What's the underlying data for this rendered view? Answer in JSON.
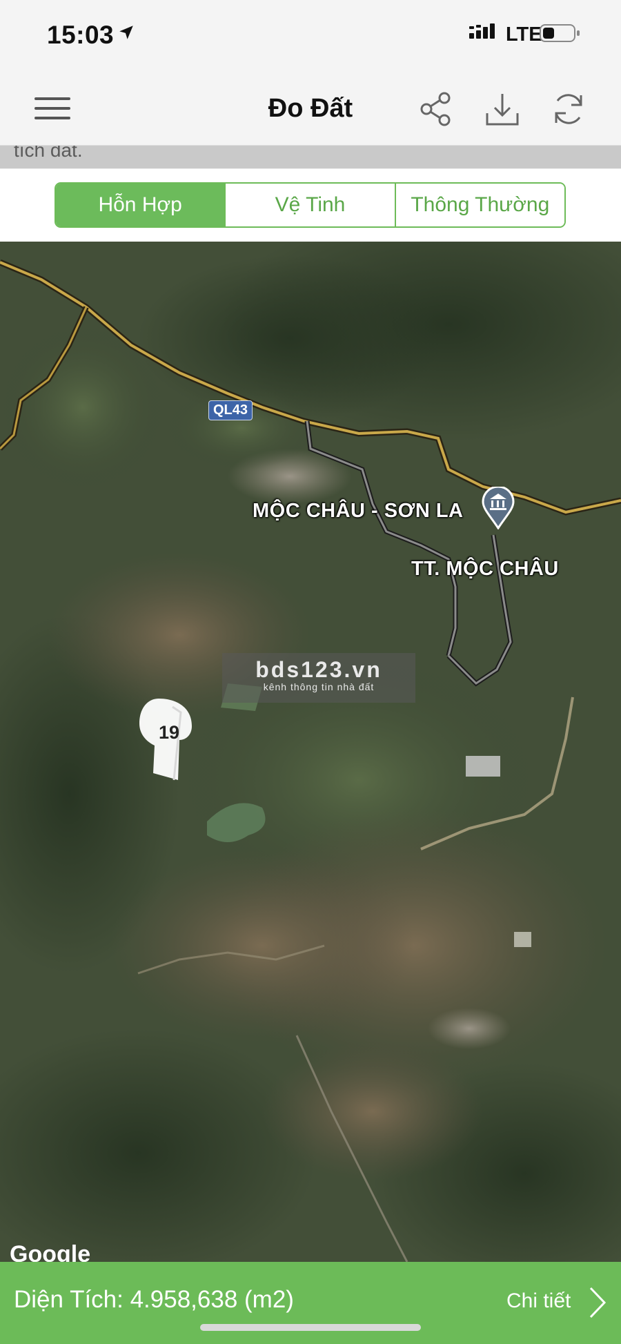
{
  "status_bar": {
    "time": "15:03",
    "network": "LTE",
    "location_icon": "location-arrow-icon",
    "signal_icon": "signal-icon",
    "battery_icon": "battery-icon"
  },
  "navbar": {
    "title": "Đo Đất",
    "menu_icon": "hamburger-menu-icon",
    "share_icon": "share-icon",
    "download_icon": "download-icon",
    "refresh_icon": "refresh-icon"
  },
  "scrolled_text": "tích đất.",
  "map_types": {
    "options": [
      "Hỗn Hợp",
      "Vệ Tinh",
      "Thông Thường"
    ],
    "selected": "Hỗn Hợp"
  },
  "map": {
    "road_shield": "QL43",
    "place_label": "MỘC CHÂU - SƠN LA",
    "town_label": "TT. MỘC CHÂU",
    "watermark_main": "bds123.vn",
    "watermark_sub": "kênh thông tin nhà đất",
    "marker_label": "19",
    "provider": "Google"
  },
  "bottom_bar": {
    "area_text": "Diện Tích: 4.958,638 (m2)",
    "detail_label": "Chi tiết",
    "chevron_icon": "chevron-right-icon"
  },
  "colors": {
    "accent_green": "#6cbb58",
    "status_bg": "#f4f4f4"
  }
}
